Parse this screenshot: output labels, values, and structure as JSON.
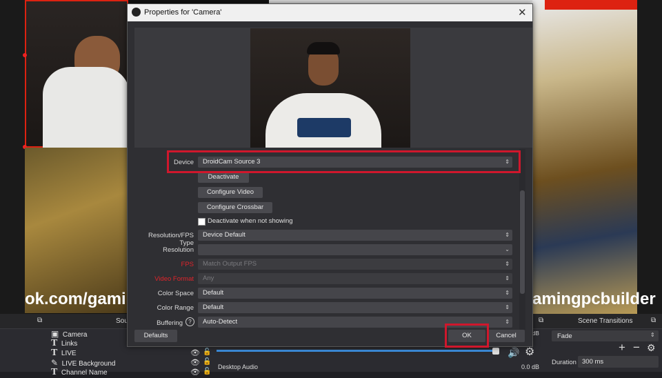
{
  "dialog": {
    "title": "Properties for 'Camera'",
    "close_glyph": "✕",
    "defaults_label": "Defaults",
    "ok_label": "OK",
    "cancel_label": "Cancel"
  },
  "properties": {
    "device_label": "Device",
    "device_value": "DroidCam Source 3",
    "deactivate_label": "Deactivate",
    "configure_video_label": "Configure Video",
    "configure_crossbar_label": "Configure Crossbar",
    "deactivate_when_not_showing_label": "Deactivate when not showing",
    "resolution_fps_type_label": "Resolution/FPS Type",
    "resolution_fps_type_value": "Device Default",
    "resolution_label": "Resolution",
    "resolution_value": "",
    "fps_label": "FPS",
    "fps_value": "Match Output FPS",
    "video_format_label": "Video Format",
    "video_format_value": "Any",
    "color_space_label": "Color Space",
    "color_space_value": "Default",
    "color_range_label": "Color Range",
    "color_range_value": "Default",
    "buffering_label": "Buffering",
    "buffering_value": "Auto-Detect"
  },
  "scene": {
    "overlay_left": "ok.com/gaming",
    "overlay_right": "amingpcbuilder"
  },
  "dock": {
    "sources_title": "Sou",
    "sources": [
      "Camera",
      "Links",
      "LIVE",
      "LIVE Background",
      "Channel Name"
    ],
    "mixer_channel": "Desktop Audio",
    "mixer_db_top": "dB",
    "mixer_db": "0.0 dB",
    "transitions_title": "Scene Transitions",
    "transition_value": "Fade",
    "duration_label": "Duration",
    "duration_value": "300 ms"
  },
  "colors": {
    "highlight": "#d0172c",
    "required_label": "#e0242b",
    "volume_bar": "#3d8fe0"
  }
}
